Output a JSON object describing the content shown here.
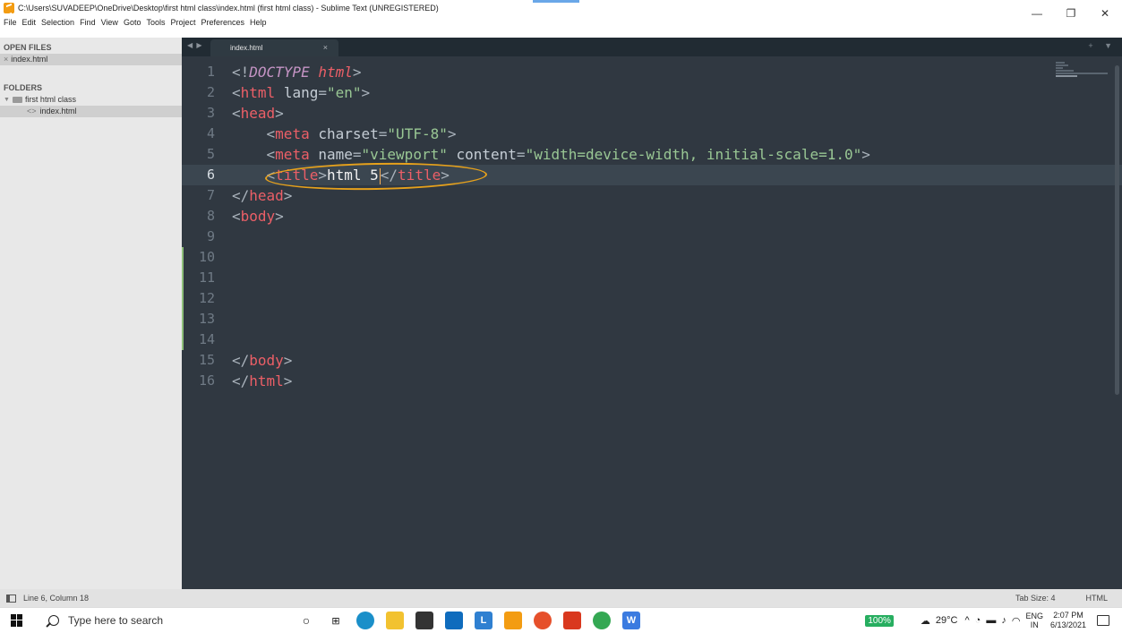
{
  "window": {
    "title": "C:\\Users\\SUVADEEP\\OneDrive\\Desktop\\first html class\\index.html (first html class) - Sublime Text (UNREGISTERED)",
    "minimize": "—",
    "maximize": "❐",
    "close": "✕"
  },
  "menu": [
    "File",
    "Edit",
    "Selection",
    "Find",
    "View",
    "Goto",
    "Tools",
    "Project",
    "Preferences",
    "Help"
  ],
  "sidebar": {
    "open_files_heading": "OPEN FILES",
    "open_file": "index.html",
    "open_file_close": "×",
    "folders_heading": "FOLDERS",
    "folder_name": "first html class",
    "folder_file": "index.html",
    "file_glyph": "<>"
  },
  "tabs": {
    "arrows": "◀ ▶",
    "active_tab": "index.html",
    "close": "×",
    "tools": "+ ▼"
  },
  "editor": {
    "line_numbers": [
      "1",
      "2",
      "3",
      "4",
      "5",
      "6",
      "7",
      "8",
      "9",
      "10",
      "11",
      "12",
      "13",
      "14",
      "15",
      "16"
    ],
    "active_line": 6
  },
  "status": {
    "position": "Line 6, Column 18",
    "tab_size": "Tab Size: 4",
    "syntax": "HTML"
  },
  "taskbar": {
    "search_placeholder": "Type here to search",
    "zoom": "100%",
    "temperature": "29°C",
    "lang_top": "ENG",
    "lang_bottom": "IN",
    "time": "2:07 PM",
    "date": "6/13/2021"
  },
  "colors": {
    "editor_bg": "#303841",
    "tag": "#ec5f67",
    "string": "#99c794",
    "keyword": "#c594c5",
    "annotation": "#e6a11c"
  }
}
